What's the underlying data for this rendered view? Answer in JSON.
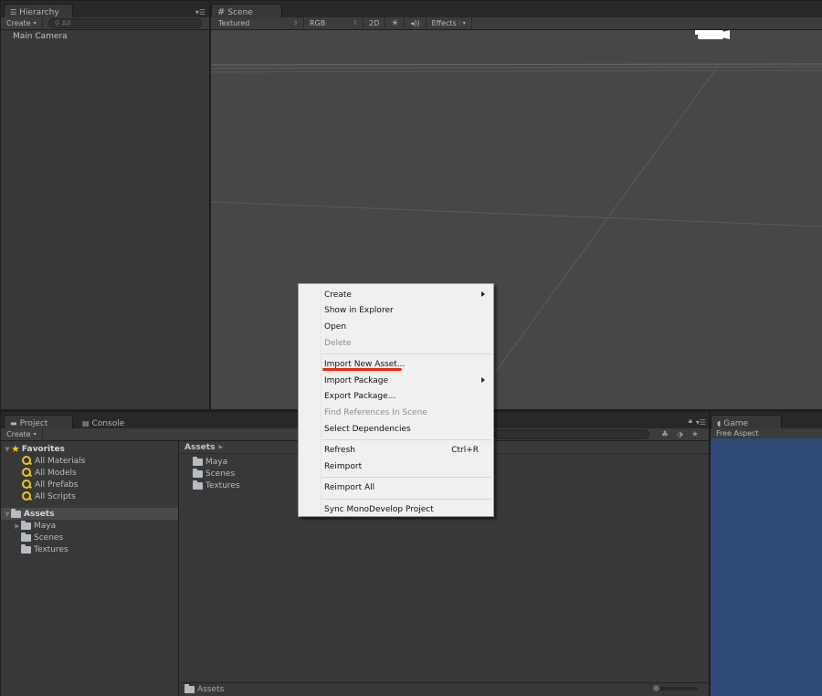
{
  "hierarchy": {
    "tab_label": "Hierarchy",
    "create_label": "Create",
    "search_placeholder": "All",
    "items": [
      "Main Camera"
    ]
  },
  "scene": {
    "tab_label": "Scene",
    "toolbar": {
      "shading_mode": "Textured",
      "render_mode": "RGB",
      "mode_2d_label": "2D",
      "effects_label": "Effects"
    }
  },
  "project": {
    "tab_label": "Project",
    "console_tab_label": "Console",
    "create_label": "Create",
    "favorites": {
      "label": "Favorites",
      "items": [
        "All Materials",
        "All Models",
        "All Prefabs",
        "All Scripts"
      ]
    },
    "assets_tree": {
      "label": "Assets",
      "items": [
        "Maya",
        "Scenes",
        "Textures"
      ]
    },
    "breadcrumb": "Assets",
    "folders": [
      "Maya",
      "Scenes",
      "Textures"
    ],
    "footer_path": "Assets"
  },
  "game": {
    "tab_label": "Game",
    "aspect_label": "Free Aspect",
    "background_color": "#2e4a78"
  },
  "context_menu": {
    "groups": [
      [
        {
          "label": "Create",
          "submenu": true,
          "enabled": true
        },
        {
          "label": "Show in Explorer",
          "enabled": true
        },
        {
          "label": "Open",
          "enabled": true
        },
        {
          "label": "Delete",
          "enabled": false
        }
      ],
      [
        {
          "label": "Import New Asset...",
          "enabled": true,
          "highlighted": true
        },
        {
          "label": "Import Package",
          "submenu": true,
          "enabled": true
        },
        {
          "label": "Export Package...",
          "enabled": true
        },
        {
          "label": "Find References In Scene",
          "enabled": false
        },
        {
          "label": "Select Dependencies",
          "enabled": true
        }
      ],
      [
        {
          "label": "Refresh",
          "shortcut": "Ctrl+R",
          "enabled": true
        },
        {
          "label": "Reimport",
          "enabled": true
        }
      ],
      [
        {
          "label": "Reimport All",
          "enabled": true
        }
      ],
      [
        {
          "label": "Sync MonoDevelop Project",
          "enabled": true
        }
      ]
    ],
    "annotation_color": "#ee2b10"
  }
}
